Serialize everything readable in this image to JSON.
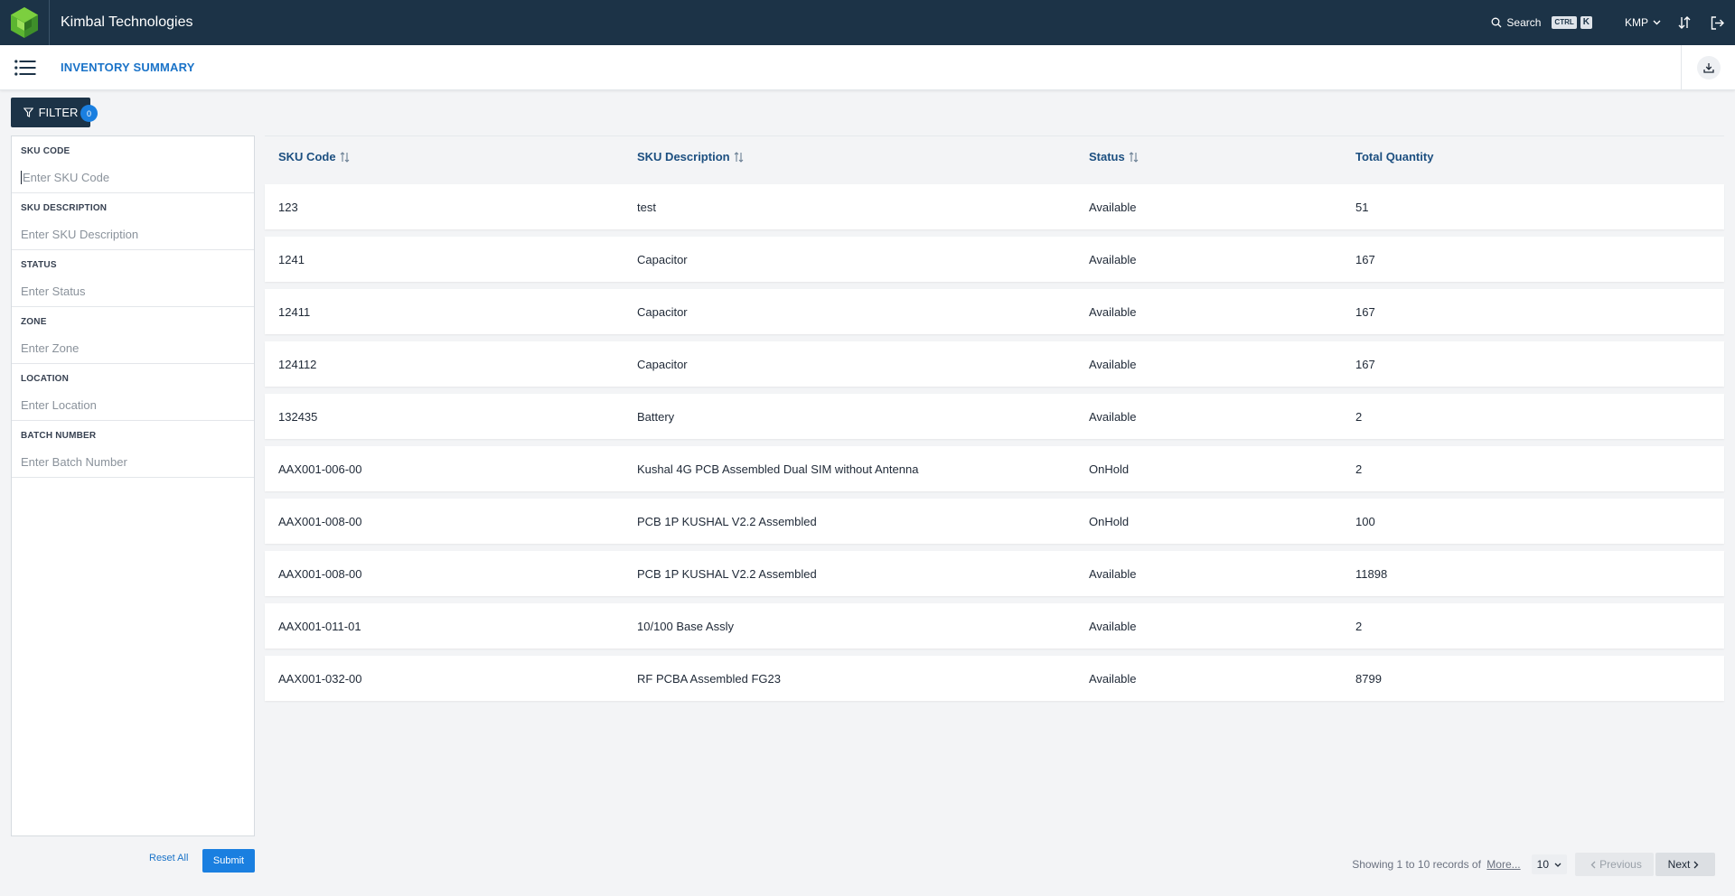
{
  "header": {
    "app_title": "Kimbal Technologies",
    "search_label": "Search",
    "shortcut_ctrl": "CTRL",
    "shortcut_key": "K",
    "user": "KMP"
  },
  "subheader": {
    "page_title": "INVENTORY SUMMARY"
  },
  "filter": {
    "button_label": "FILTER",
    "badge_count": "0",
    "fields": [
      {
        "label": "SKU CODE",
        "placeholder": "Enter SKU Code"
      },
      {
        "label": "SKU DESCRIPTION",
        "placeholder": "Enter SKU Description"
      },
      {
        "label": "STATUS",
        "placeholder": "Enter Status"
      },
      {
        "label": "ZONE",
        "placeholder": "Enter Zone"
      },
      {
        "label": "LOCATION",
        "placeholder": "Enter Location"
      },
      {
        "label": "BATCH NUMBER",
        "placeholder": "Enter Batch Number"
      }
    ],
    "reset_label": "Reset All",
    "submit_label": "Submit"
  },
  "table": {
    "columns": [
      "SKU Code",
      "SKU Description",
      "Status",
      "Total Quantity"
    ],
    "rows": [
      [
        "123",
        "test",
        "Available",
        "51"
      ],
      [
        "1241",
        "Capacitor",
        "Available",
        "167"
      ],
      [
        "12411",
        "Capacitor",
        "Available",
        "167"
      ],
      [
        "124112",
        "Capacitor",
        "Available",
        "167"
      ],
      [
        "132435",
        "Battery",
        "Available",
        "2"
      ],
      [
        "AAX001-006-00",
        "Kushal 4G PCB Assembled Dual SIM without Antenna",
        "OnHold",
        "2"
      ],
      [
        "AAX001-008-00",
        "PCB 1P KUSHAL V2.2 Assembled",
        "OnHold",
        "100"
      ],
      [
        "AAX001-008-00",
        "PCB 1P KUSHAL V2.2 Assembled",
        "Available",
        "11898"
      ],
      [
        "AAX001-011-01",
        "10/100 Base Assly",
        "Available",
        "2"
      ],
      [
        "AAX001-032-00",
        "RF PCBA Assembled FG23",
        "Available",
        "8799"
      ]
    ]
  },
  "pagination": {
    "showing_text": "Showing 1 to 10 records of",
    "more_label": "More...",
    "page_size": "10",
    "prev_label": "Previous",
    "next_label": "Next"
  },
  "colors": {
    "topbar": "#1c3347",
    "accent": "#1a7fe0",
    "title_blue": "#1a73c8",
    "logo_green": "#5cb531"
  }
}
